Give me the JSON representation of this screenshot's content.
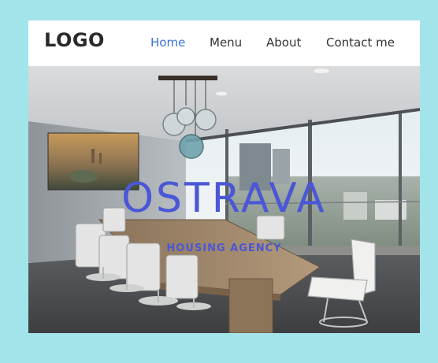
{
  "header": {
    "logo": "LOGO",
    "nav": [
      {
        "label": "Home",
        "active": true
      },
      {
        "label": "Menu",
        "active": false
      },
      {
        "label": "About",
        "active": false
      },
      {
        "label": "Contact me",
        "active": false
      }
    ]
  },
  "hero": {
    "title": "OSTRAVA",
    "subtitle": "HOUSING AGENCY",
    "image": "conference-room-photo"
  },
  "colors": {
    "page_background": "#a3e3ea",
    "nav_active": "#3b73d6",
    "nav_text": "#333333",
    "hero_text": "#4a57d6"
  }
}
